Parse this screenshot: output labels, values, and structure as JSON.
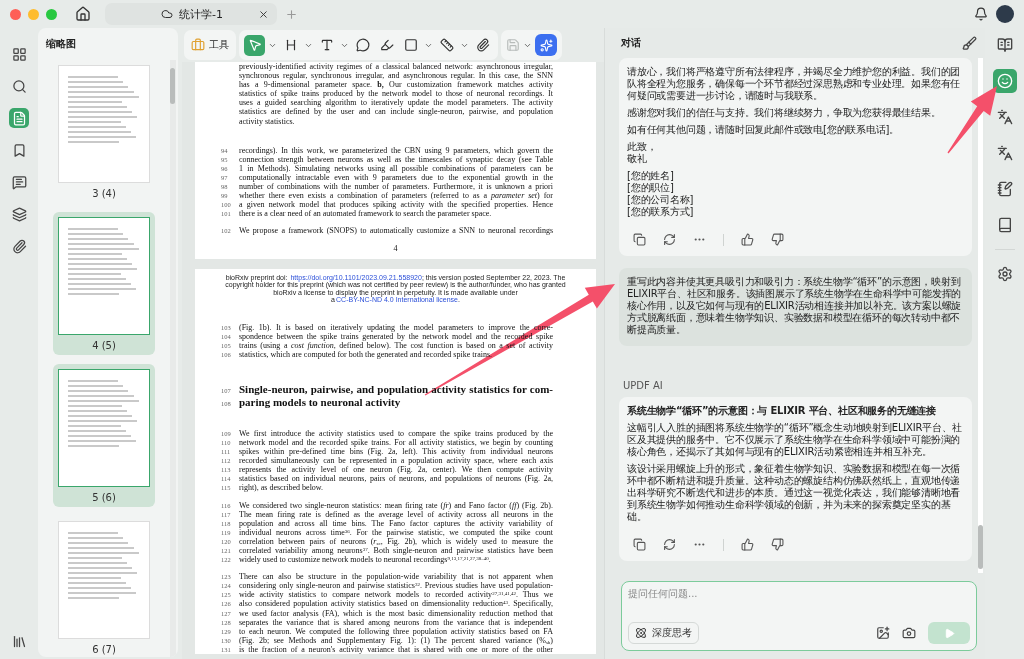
{
  "window": {
    "tab_title": "统计学-1"
  },
  "left_rail": [
    {
      "kind": "grid",
      "selected": false
    },
    {
      "kind": "search",
      "selected": false
    },
    {
      "kind": "pages",
      "selected": true
    },
    {
      "kind": "bookmark",
      "selected": false
    },
    {
      "kind": "comments",
      "selected": false
    },
    {
      "kind": "layers",
      "selected": false
    },
    {
      "kind": "attachments",
      "selected": false
    }
  ],
  "sidebar": {
    "title": "缩略图",
    "thumbnails": [
      {
        "label": "3 (4)",
        "selected": false
      },
      {
        "label": "4 (5)",
        "selected": true
      },
      {
        "label": "5 (6)",
        "selected": true
      },
      {
        "label": "6 (7)",
        "selected": false
      }
    ]
  },
  "toolbar": {
    "tools_label": "工具",
    "save_disabled": true,
    "tools": [
      {
        "kind": "select",
        "selected": true,
        "caret": true
      },
      {
        "kind": "heading",
        "selected": false,
        "caret": true
      },
      {
        "kind": "text",
        "selected": false,
        "caret": true
      },
      {
        "kind": "comment",
        "selected": false,
        "caret": false
      },
      {
        "kind": "pen",
        "selected": false,
        "caret": false
      },
      {
        "kind": "shape",
        "selected": false,
        "caret": true
      },
      {
        "kind": "stamp",
        "selected": false,
        "caret": true
      },
      {
        "kind": "attach",
        "selected": false,
        "caret": false
      }
    ]
  },
  "document": {
    "pages": [
      {
        "blocks": [
          {
            "kind": "caption",
            "continues": false,
            "lines": [
              {
                "text": "previously-identified activity regimes of a classical balanced network: asynchronous irregular,"
              },
              {
                "text": "synchronous regular, synchronous irregular, and asynchronous regular. In this case, the SNN"
              },
              {
                "text": "has a 9-dimensional parameter space. **b,** Our customization framework matches activity"
              },
              {
                "text": "statistics of spike trains produced by the network model to those of neuronal recordings. It"
              },
              {
                "text": "uses a guided searching algorithm to iteratively update the model parameters. The activity"
              },
              {
                "text": "statistics are defined by the user and can include single-neuron, pairwise, and population"
              },
              {
                "text": "activity statistics."
              }
            ]
          },
          {
            "kind": "paragraph",
            "continues": false,
            "lines": [
              {
                "no": "94",
                "text": "recordings). In this work, we parameterized the CBN using 9 parameters, which govern the"
              },
              {
                "no": "95",
                "text": "connection strength between neurons as well as the timescales of synaptic decay (see Table"
              },
              {
                "no": "96",
                "text": "1 in Methods). Simulating networks using all possible combinations of parameters can be"
              },
              {
                "no": "97",
                "text": "computationally intractable even with 9 parameters due to the exponential growth in the"
              },
              {
                "no": "98",
                "text": "number of combinations with the number of parameters. Furthermore, it is unknown a priori"
              },
              {
                "no": "99",
                "text": "whether there even exists a combination of parameters (referred to as a *parameter set*) for"
              },
              {
                "no": "100",
                "text": "a given network model that produces spiking activity with the specified properties. Hence"
              },
              {
                "no": "101",
                "text": "there is a clear need of an automated framework to search the parameter space."
              }
            ]
          },
          {
            "kind": "paragraph",
            "continues": true,
            "lines": [
              {
                "no": "102",
                "text": "We propose a framework (SNOPS) to automatically customize a SNN to neuronal recordings"
              }
            ]
          }
        ],
        "page_number": "4"
      },
      {
        "footer": {
          "before": "bioRxiv preprint doi: ",
          "doi_link": "https://doi.org/10.1101/2023.09.21.558920",
          "middle": "; this version posted September 22, 2023. The copyright holder for this preprint (which was not certified by peer review) is the author/funder, who has granted bioRxiv a license to display the preprint in perpetuity. It is made available under a",
          "license_link": "CC-BY-NC-ND 4.0 International license",
          "after": "."
        },
        "blocks": [
          {
            "kind": "paragraph",
            "continues": false,
            "lines": [
              {
                "no": "103",
                "text": "(Fig. 1b). It is based on iteratively updating the model parameters to improve the corre-"
              },
              {
                "no": "104",
                "text": "spondence between the spike trains generated by the network model and the recorded spike"
              },
              {
                "no": "105",
                "text": "trains (using a *cost function*, defined below). The cost function is based on a set of activity"
              },
              {
                "no": "106",
                "text": "statistics, which are computed for both the generated and recorded spike trains."
              }
            ]
          },
          {
            "kind": "heading",
            "continues": false,
            "lines": [
              {
                "no": "107",
                "text": "Single-neuron, pairwise, and population activity statistics for com-"
              },
              {
                "no": "108",
                "text": "paring models to neuronal activity"
              }
            ]
          },
          {
            "kind": "paragraph",
            "continues": false,
            "lines": [
              {
                "no": "109",
                "text": "We first introduce the activity statistics used to compare the spike trains produced by the"
              },
              {
                "no": "110",
                "text": "network model and the recorded spike trains. For all activity statistics, we begin by counting"
              },
              {
                "no": "111",
                "text": "spikes within pre-defined time bins (Fig. 2a, left). This activity from individual neurons"
              },
              {
                "no": "112",
                "text": "recorded simultaneously can be represented in a population activity space, where each axis"
              },
              {
                "no": "113",
                "text": "represents the activity level of one neuron (Fig. 2a, center). We then compute activity"
              },
              {
                "no": "114",
                "text": "statistics based on individual neurons, pairs of neurons, and populations of neurons (Fig. 2a,"
              },
              {
                "no": "115",
                "text": "right), as described below."
              }
            ]
          },
          {
            "kind": "paragraph",
            "continues": false,
            "lines": [
              {
                "no": "116",
                "text": "We considered two single-neuron statistics: mean firing rate (*fr*) and Fano factor (*ff*) (Fig. 2b)."
              },
              {
                "no": "117",
                "text": "The mean firing rate is defined as the average level of activity across all neurons in the"
              },
              {
                "no": "118",
                "text": "population and across all time bins. The Fano factor captures the activity variability of"
              },
              {
                "no": "119",
                "text": "individual neurons across time$^{36}$. For the pairwise statistic, we computed the spike count"
              },
              {
                "no": "120",
                "text": "correlation between pairs of neurons (*r*$_{sc}$, Fig. 2b), which is widely used to measure the"
              },
              {
                "no": "121",
                "text": "correlated variability among neurons$^{37}$. Both single-neuron and pairwise statistics have been"
              },
              {
                "no": "122",
                "text": "widely used to customize network models to neuronal recordings$^{9,13,17,21,27,38–40}$."
              }
            ]
          },
          {
            "kind": "paragraph",
            "continues": true,
            "lines": [
              {
                "no": "123",
                "text": "There can also be structure in the population-wide variability that is not apparent when"
              },
              {
                "no": "124",
                "text": "considering only single-neuron and pairwise statistics$^{32}$. Previous studies have used population-"
              },
              {
                "no": "125",
                "text": "wide activity statistics to compare network models to recorded activity$^{27,31,41,42}$. Thus we"
              },
              {
                "no": "126",
                "text": "also considered population activity statistics based on dimensionality reduction$^{43}$. Specifically,"
              },
              {
                "no": "127",
                "text": "we used factor analysis (FA), which is the most basic dimensionality reduction method that"
              },
              {
                "no": "128",
                "text": "separates the variance that is shared among neurons from the variance that is independent"
              },
              {
                "no": "129",
                "text": "to each neuron. We computed the following three population activity statistics based on FA"
              },
              {
                "no": "130",
                "text": "(Fig. 2b; see Methods and Supplementary Fig. 1): (1) The percent shared variance (%$_{sh}$)"
              },
              {
                "no": "131",
                "text": "is the fraction of a neuron's activity variance that is shared with one or more of the other"
              }
            ]
          }
        ]
      }
    ]
  },
  "chat": {
    "title": "对话",
    "messages": [
      {
        "kind": "ai",
        "paragraphs": [
          [
            "请放心，我们将严格遵守所有法律程序，并竭尽全力维护您的利益。我们的团队将全程为您服务，确保每一个环节都经过深思熟虑和专业处理。如果您有任何疑问或需要进一步讨论，请随时与我联系。"
          ],
          [
            "感谢您对我们的信任与支持。我们将继续努力，争取为您获得最佳结果。"
          ],
          [
            "如有任何其他问题，请随时回复此邮件或致电[您的联系电话]。"
          ],
          [
            "此致，",
            "敬礼"
          ],
          [
            "[您的姓名]",
            "[您的职位]",
            "[您的公司名称]",
            "[您的联系方式]"
          ]
        ]
      },
      {
        "kind": "user",
        "text": "重写此内容并使其更具吸引力和吸引力：系统生物学“循环”的示意图，映射到ELIXIR平台、社区和服务。该插图展示了系统生物学在生命科学中可能发挥的核心作用，以及它如何与现有的ELIXIR活动相连接并加以补充。该方案以螺旋方式脱离纸面，意味着生物学知识、实验数据和模型在循环的每次转动中都不断提高质量。"
      },
      {
        "kind": "ai",
        "sender": "UPDF AI",
        "title": "系统生物学“循环”的示意图：与 ELIXIR 平台、社区和服务的无缝连接",
        "paragraphs": [
          [
            "这幅引人入胜的插图将系统生物学的“循环”概念生动地映射到ELIXIR平台、社区及其提供的服务中。它不仅展示了系统生物学在生命科学领域中可能扮演的核心角色，还揭示了其如何与现有的ELIXIR活动紧密相连并相互补充。"
          ],
          [
            "该设计采用螺旋上升的形式，象征着生物学知识、实验数据和模型在每一次循环中都不断精进和提升质量。这种动态的螺旋结构仿佛跃然纸上，直观地传递出科学研究不断迭代和进步的本质。通过这一视觉化表达，我们能够清晰地看到系统生物学如何推动生命科学领域的创新，并为未来的探索奠定坚实的基础。"
          ]
        ]
      }
    ],
    "input": {
      "placeholder": "提问任何问题...",
      "deep_think_label": "深度思考",
      "send_disabled": true
    }
  },
  "right_rail": [
    {
      "kind": "reader",
      "selected": false
    },
    {
      "kind": "ai-chat",
      "selected": true
    },
    {
      "kind": "translate",
      "selected": false
    },
    {
      "kind": "translate-doc",
      "selected": false
    },
    {
      "kind": "summary",
      "selected": false
    },
    {
      "kind": "book",
      "selected": false
    },
    {
      "kind": "settings",
      "selected": false
    }
  ]
}
